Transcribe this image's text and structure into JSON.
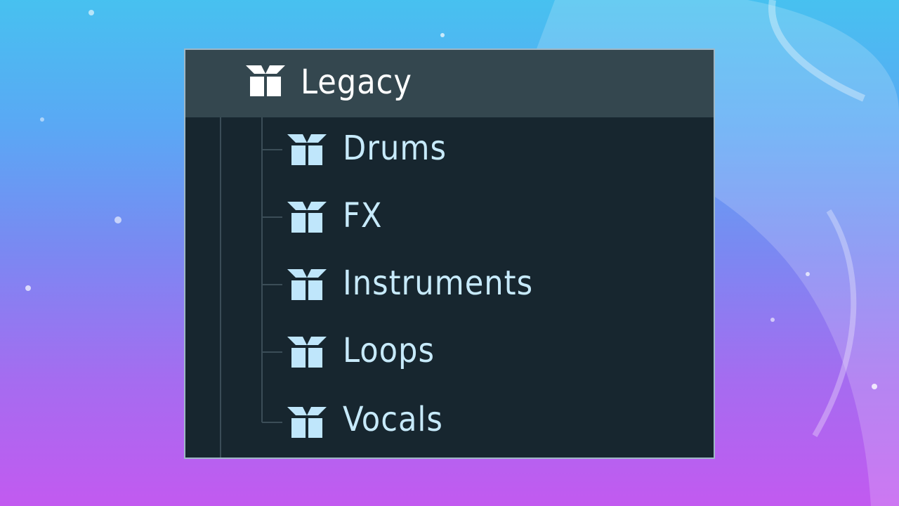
{
  "tree": {
    "root": {
      "label": "Legacy",
      "icon": "package-icon"
    },
    "children": [
      {
        "label": "Drums",
        "icon": "package-icon"
      },
      {
        "label": "FX",
        "icon": "package-icon"
      },
      {
        "label": "Instruments",
        "icon": "package-icon"
      },
      {
        "label": "Loops",
        "icon": "package-icon"
      },
      {
        "label": "Vocals",
        "icon": "package-icon"
      }
    ]
  },
  "colors": {
    "panel_bg": "#17262f",
    "selected_row_bg": "#34474f",
    "root_icon": "#ffffff",
    "child_icon": "#bfe6fb",
    "tree_line": "#3b4d57"
  }
}
